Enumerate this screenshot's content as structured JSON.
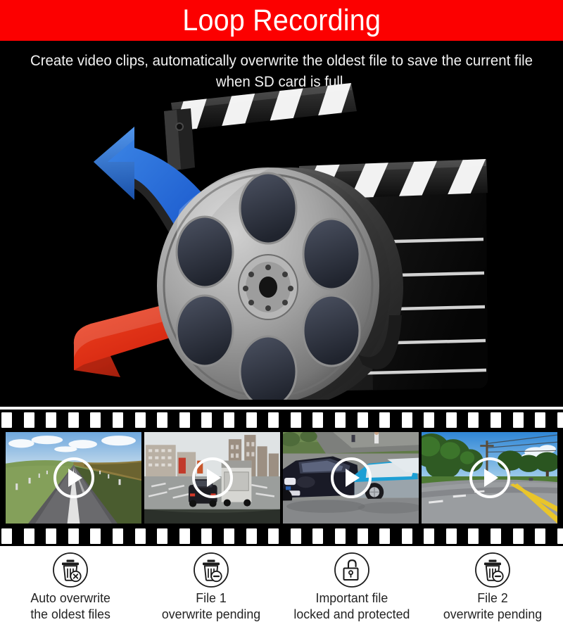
{
  "banner": {
    "title": "Loop Recording",
    "bg_color": "#fc0000",
    "text_color": "#ffffff"
  },
  "hero": {
    "subtitle": "Create video clips, automatically overwrite the oldest file to save the current file when SD card is full.",
    "bg_color": "#000000",
    "artwork": {
      "name": "film-reel-clapperboard-illustration",
      "elements": [
        "film-reel",
        "clapperboard",
        "blue-up-arrow",
        "red-down-arrow"
      ],
      "blue_arrow_color": "#1f5fd0",
      "red_arrow_color": "#d92b13",
      "reel_color": "#9a9a9a"
    }
  },
  "filmstrip": {
    "bg_color": "#000000",
    "perforation_color": "#ffffff",
    "perforation_count": 38,
    "frames": [
      {
        "name": "countryside-highway-clip",
        "play_icon": "play-icon",
        "scene": "open countryside highway with green hills and blue sky"
      },
      {
        "name": "city-traffic-clip",
        "play_icon": "play-icon",
        "scene": "urban street dashcam view with truck and high-rise buildings"
      },
      {
        "name": "car-collision-clip",
        "play_icon": "play-icon",
        "scene": "dark sedan and blue car collision on residential road"
      },
      {
        "name": "tree-lined-road-clip",
        "play_icon": "play-icon",
        "scene": "tree-lined suburban road with yellow center line"
      }
    ]
  },
  "features": [
    {
      "icon": "trash-x-icon",
      "label": "Auto overwrite\nthe oldest files"
    },
    {
      "icon": "trash-minus-icon",
      "label": "File 1\noverwrite pending"
    },
    {
      "icon": "unlocked-padlock-icon",
      "label": "Important file\nlocked and protected"
    },
    {
      "icon": "trash-minus-icon",
      "label": "File 2\noverwrite pending"
    }
  ],
  "colors": {
    "accent_red": "#fc0000",
    "background_black": "#000000",
    "background_white": "#ffffff",
    "label_text": "#232323"
  }
}
